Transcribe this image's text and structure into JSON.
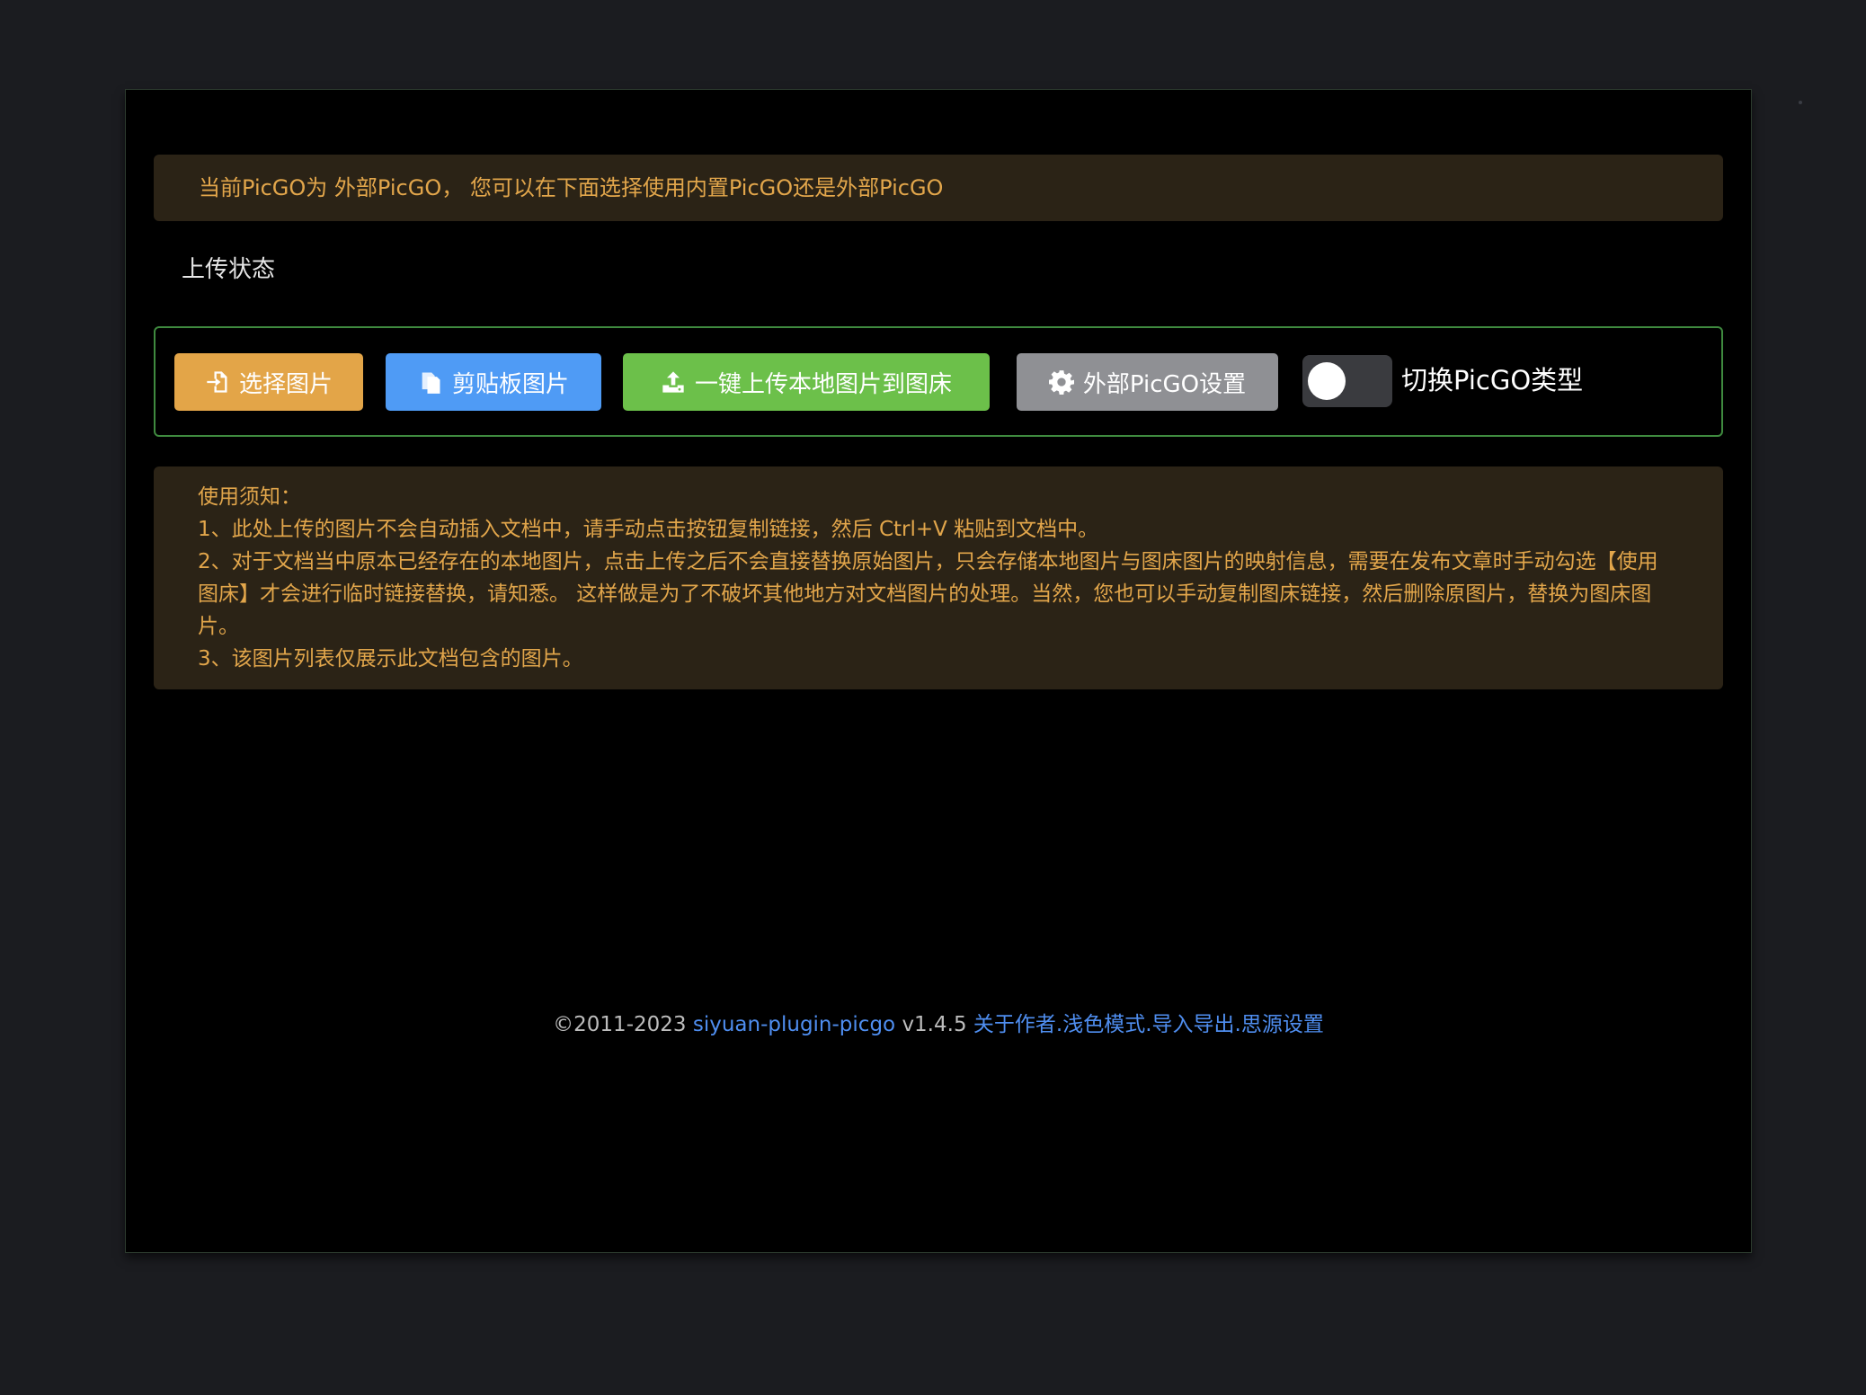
{
  "notice_top": {
    "text": "当前PicGO为 外部PicGO， 您可以在下面选择使用内置PicGO还是外部PicGO"
  },
  "status": {
    "label": "上传状态"
  },
  "toolbar": {
    "select_image": "选择图片",
    "clipboard_image": "剪贴板图片",
    "upload_all": "一键上传本地图片到图床",
    "external_settings": "外部PicGO设置",
    "toggle_label": "切换PicGO类型",
    "toggle_on": false
  },
  "notice_bottom": {
    "title": "使用须知：",
    "lines": [
      "1、此处上传的图片不会自动插入文档中，请手动点击按钮复制链接，然后 Ctrl+V 粘贴到文档中。",
      "2、对于文档当中原本已经存在的本地图片，点击上传之后不会直接替换原始图片，只会存储本地图片与图床图片的映射信息，需要在发布文章时手动勾选【使用图床】才会进行临时链接替换，请知悉。 这样做是为了不破坏其他地方对文档图片的处理。当然，您也可以手动复制图床链接，然后删除原图片，替换为图床图片。",
      "3、该图片列表仅展示此文档包含的图片。"
    ]
  },
  "footer": {
    "copyright": "©2011-2023",
    "project_link": "siyuan-plugin-picgo",
    "version": "v1.4.5",
    "about_link": "关于作者",
    "theme_link": "浅色模式",
    "import_link": "导入导出",
    "siyuan_link": "思源设置",
    "separator": "."
  },
  "colors": {
    "select_button": "#e3a548",
    "clipboard_button": "#4f9bf5",
    "upload_button": "#6cc04a",
    "settings_button": "#8f9094",
    "notice_text": "#e2a64b",
    "link": "#4f8ef0"
  },
  "icons": {
    "select_image": "file-import-icon",
    "clipboard_image": "copy-files-icon",
    "upload_all": "upload-icon",
    "external_settings": "gear-icon"
  }
}
